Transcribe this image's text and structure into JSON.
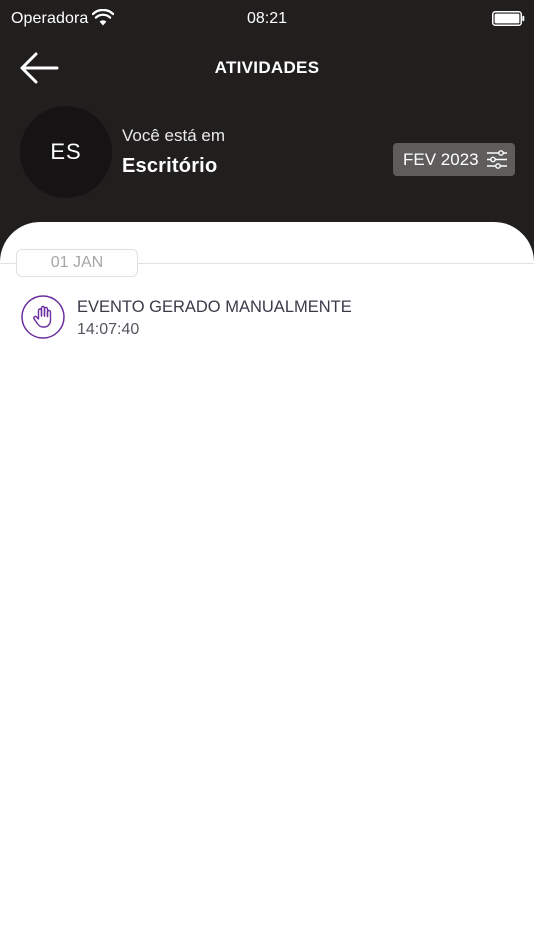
{
  "status_bar": {
    "carrier": "Operadora",
    "time": "08:21"
  },
  "header": {
    "title": "ATIVIDADES",
    "avatar_initials": "ES",
    "location_prefix": "Você está em",
    "location_name": "Escritório",
    "period_filter_label": "FEV 2023"
  },
  "icons": {
    "back": "arrow-left-icon",
    "filter": "sliders-icon",
    "event": "hand-icon",
    "wifi": "wifi-icon",
    "battery": "battery-icon"
  },
  "colors": {
    "header_bg": "#211e1e",
    "accent_purple": "#6b2fa0",
    "filter_bg": "#5f5c5c"
  },
  "activities": {
    "groups": [
      {
        "date": "01 JAN",
        "events": [
          {
            "title": "EVENTO GERADO MANUALMENTE",
            "time": "14:07:40"
          }
        ]
      }
    ]
  }
}
